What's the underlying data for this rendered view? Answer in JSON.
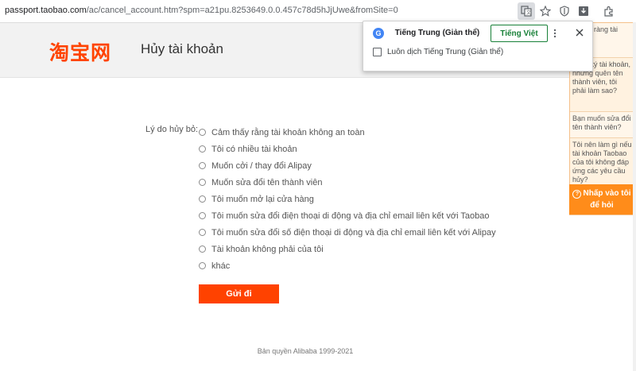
{
  "browser": {
    "url_host": "passport.taobao.com",
    "url_rest": "/ac/cancel_account.htm?spm=a21pu.8253649.0.0.457c78d5hJjUwe&fromSite=0"
  },
  "header": {
    "logo": "淘宝网",
    "title": "Hủy tài khoản"
  },
  "form": {
    "reason_label": "Lý do hủy bỏ:",
    "options": [
      "Cảm thấy rằng tài khoản không an toàn",
      "Tôi có nhiều tài khoản",
      "Muốn cởi / thay đổi Alipay",
      "Muốn sửa đổi tên thành viên",
      "Tôi muốn mở lại cửa hàng",
      "Tôi muốn sửa đổi điện thoại di động và địa chỉ email liên kết với Taobao",
      "Tôi muốn sửa đổi số điện thoại di động và địa chỉ email liên kết với Alipay",
      "Tài khoản không phải của tôi",
      "khác"
    ],
    "submit_label": "Gửi đi"
  },
  "footer": {
    "copyright": "Bản quyền Alibaba 1999-2021"
  },
  "translate_popup": {
    "source_lang": "Tiếng Trung (Giản thể)",
    "target_lang": "Tiếng Việt",
    "always_translate": "Luôn dịch Tiếng Trung (Giản thể)",
    "always_checked": false
  },
  "help_panel": {
    "questions": [
      "n kết / ràng tài khoản",
      "đăng ký tài khoản, nhưng quên tên thành viên, tôi phải làm sao?",
      "Bạn muốn sửa đổi tên thành viên?",
      "Tôi nên làm gì nếu tài khoản Taobao của tôi không đáp ứng các yêu cầu hủy?"
    ],
    "cta": "Nhấp vào tôi để hỏi"
  },
  "colors": {
    "brand": "#ff4400",
    "submit": "#ff4200",
    "help_cta": "#ff8c1a",
    "translate_accent": "#188038"
  }
}
